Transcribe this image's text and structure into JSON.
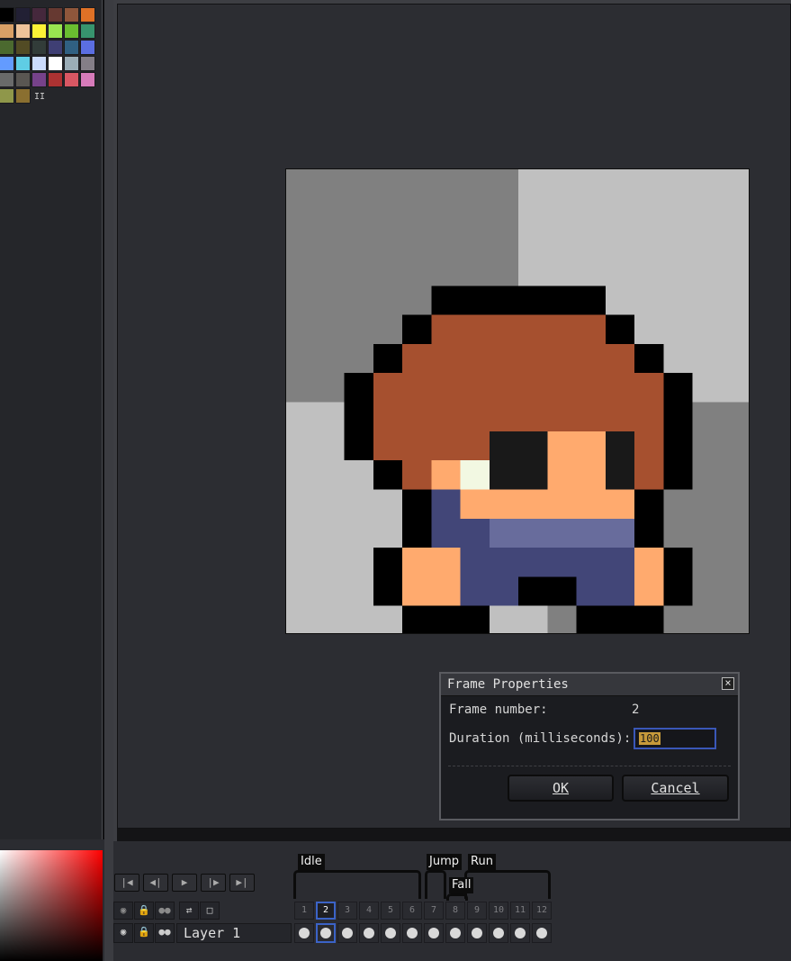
{
  "palette": {
    "colors": [
      "#000000",
      "#222034",
      "#45283c",
      "#663931",
      "#8f563b",
      "#df7126",
      "#d9a066",
      "#eec39a",
      "#fbf236",
      "#99e550",
      "#6abe30",
      "#37946e",
      "#4b692f",
      "#524b24",
      "#323c39",
      "#3f3f74",
      "#306082",
      "#5b6ee1",
      "#639bff",
      "#5fcde4",
      "#cbdbfc",
      "#ffffff",
      "#9badb7",
      "#847e87",
      "#696a6a",
      "#595652",
      "#76428a",
      "#ac3232",
      "#d95763",
      "#d77bba",
      "#8f974a",
      "#8a6f30"
    ],
    "more_indicator": "II"
  },
  "sprite": {
    "background_colors": [
      "#808080",
      "#c0c0c0"
    ],
    "pixel_colors": {
      "K": "#000000",
      "H": "#a6502f",
      "S": "#ffaa6e",
      "E": "#191919",
      "W": "#f2f8e2",
      "N": "#424678",
      "L": "#686c9c",
      "D": "#808080",
      "T": "#c0c0c0"
    },
    "pixels": [
      "................",
      "................",
      "................",
      ".....KKKKKK.....",
      "....KHHHHHHK....",
      "...KHHHHHHHHK...",
      "..KHHHHHHHHHHK..",
      "..KHHHHHHHHHHK..",
      "..KHHHHEESSEHK..",
      "...KHSWEESSEHK..",
      "....KNSSSSSSK...",
      "....KNNLLLLLK...",
      "...KSSNNNNNNSK..",
      "...KSSNNKKNNSK..",
      "....KKK.TDKKK..."
    ]
  },
  "dialog": {
    "title": "Frame Properties",
    "close_glyph": "×",
    "frame_number_label": "Frame number:",
    "frame_number_value": "2",
    "duration_label": "Duration (milliseconds):",
    "duration_value": "100",
    "ok_label": "OK",
    "cancel_label": "Cancel"
  },
  "playback": {
    "first_frame_glyph": "|◀",
    "prev_frame_glyph": "◀|",
    "play_glyph": "▶",
    "next_frame_glyph": "|▶",
    "last_frame_glyph": "▶|"
  },
  "tags": {
    "idle": "Idle",
    "jump": "Jump",
    "run": "Run",
    "fall": "Fall"
  },
  "timeline": {
    "header_icons": [
      "eye-icon",
      "lock-icon",
      "link-icon",
      "layers-icon",
      "square-icon"
    ],
    "header_glyphs": [
      "◉",
      "🔒",
      "●●",
      "⇄",
      "□"
    ],
    "layer": {
      "eye_glyph": "◉",
      "lock_glyph": "🔒",
      "link_glyph": "●●",
      "name": "Layer 1"
    },
    "frames": [
      "1",
      "2",
      "3",
      "4",
      "5",
      "6",
      "7",
      "8",
      "9",
      "10",
      "11",
      "12"
    ],
    "active_frame": "2"
  }
}
